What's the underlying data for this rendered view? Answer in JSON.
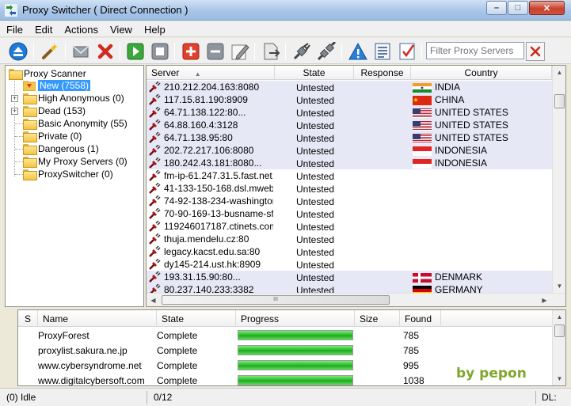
{
  "window": {
    "title": "Proxy Switcher  ( Direct Connection )",
    "minimize": "–",
    "maximize": "□",
    "close": "✕"
  },
  "menu": [
    "File",
    "Edit",
    "Actions",
    "View",
    "Help"
  ],
  "toolbar": {
    "buttons": [
      "eject-icon",
      "magic-wand-icon",
      "envelope-icon",
      "delete-icon",
      "play-icon",
      "stop-icon",
      "add-icon",
      "remove-icon",
      "edit-icon",
      "export-icon",
      "plug-connect-icon",
      "plug-disconnect-icon",
      "warning-icon",
      "list-icon",
      "checklist-icon"
    ],
    "filter_placeholder": "Filter Proxy Servers",
    "filter_clear": "clear-filter-icon"
  },
  "tree": {
    "root": "Proxy Scanner",
    "items": [
      {
        "label": "New (7558)",
        "selected": true,
        "expander": ""
      },
      {
        "label": "High Anonymous (0)",
        "expander": "+"
      },
      {
        "label": "Dead (153)",
        "expander": "+"
      },
      {
        "label": "Basic Anonymity (55)",
        "expander": ""
      },
      {
        "label": "Private (0)",
        "expander": ""
      },
      {
        "label": "Dangerous (1)",
        "expander": ""
      },
      {
        "label": "My Proxy Servers (0)",
        "expander": ""
      },
      {
        "label": "ProxySwitcher (0)",
        "expander": ""
      }
    ]
  },
  "server_list": {
    "columns": [
      "Server",
      "State",
      "Response",
      "Country"
    ],
    "sort_indicator": "▲",
    "rows": [
      {
        "server": "210.212.204.163:8080",
        "state": "Untested",
        "country": "INDIA",
        "flag": "in"
      },
      {
        "server": "117.15.81.190:8909",
        "state": "Untested",
        "country": "CHINA",
        "flag": "cn"
      },
      {
        "server": "64.71.138.122:80...",
        "state": "Untested",
        "country": "UNITED STATES",
        "flag": "us"
      },
      {
        "server": "64.88.160.4:3128",
        "state": "Untested",
        "country": "UNITED STATES",
        "flag": "us"
      },
      {
        "server": "64.71.138.95:80",
        "state": "Untested",
        "country": "UNITED STATES",
        "flag": "us"
      },
      {
        "server": "202.72.217.106:8080",
        "state": "Untested",
        "country": "INDONESIA",
        "flag": "id"
      },
      {
        "server": "180.242.43.181:8080...",
        "state": "Untested",
        "country": "INDONESIA",
        "flag": "id"
      },
      {
        "server": "fm-ip-61.247.31.5.fast.net.id:",
        "state": "Untested",
        "country": "",
        "flag": ""
      },
      {
        "server": "41-133-150-168.dsl.mweb.co",
        "state": "Untested",
        "country": "",
        "flag": ""
      },
      {
        "server": "74-92-138-234-washingtondc",
        "state": "Untested",
        "country": "",
        "flag": ""
      },
      {
        "server": "70-90-169-13-busname-sf...",
        "state": "Untested",
        "country": "",
        "flag": ""
      },
      {
        "server": "119246017187.ctinets.com:8",
        "state": "Untested",
        "country": "",
        "flag": ""
      },
      {
        "server": "thuja.mendelu.cz:80",
        "state": "Untested",
        "country": "",
        "flag": ""
      },
      {
        "server": "legacy.kacst.edu.sa:80",
        "state": "Untested",
        "country": "",
        "flag": ""
      },
      {
        "server": "dy145-214.ust.hk:8909",
        "state": "Untested",
        "country": "",
        "flag": ""
      },
      {
        "server": "193.31.15.90:80...",
        "state": "Untested",
        "country": "DENMARK",
        "flag": "dk"
      },
      {
        "server": "80.237.140.233:3382",
        "state": "Untested",
        "country": "GERMANY",
        "flag": "de"
      }
    ],
    "hscroll_grip": "III"
  },
  "downloads": {
    "columns": [
      "S",
      "Name",
      "State",
      "Progress",
      "Size",
      "Found"
    ],
    "rows": [
      {
        "name": "ProxyForest",
        "state": "Complete",
        "progress": 1.0,
        "size": "",
        "found": "785"
      },
      {
        "name": "proxylist.sakura.ne.jp",
        "state": "Complete",
        "progress": 1.0,
        "size": "",
        "found": "785"
      },
      {
        "name": "www.cybersyndrome.net",
        "state": "Complete",
        "progress": 1.0,
        "size": "",
        "found": "995"
      },
      {
        "name": "www.digitalcybersoft.com",
        "state": "Complete",
        "progress": 1.0,
        "size": "",
        "found": "1038"
      }
    ]
  },
  "watermark": "by pepon",
  "status": {
    "left": "(0) Idle",
    "middle": "0/12",
    "right": "DL:"
  }
}
